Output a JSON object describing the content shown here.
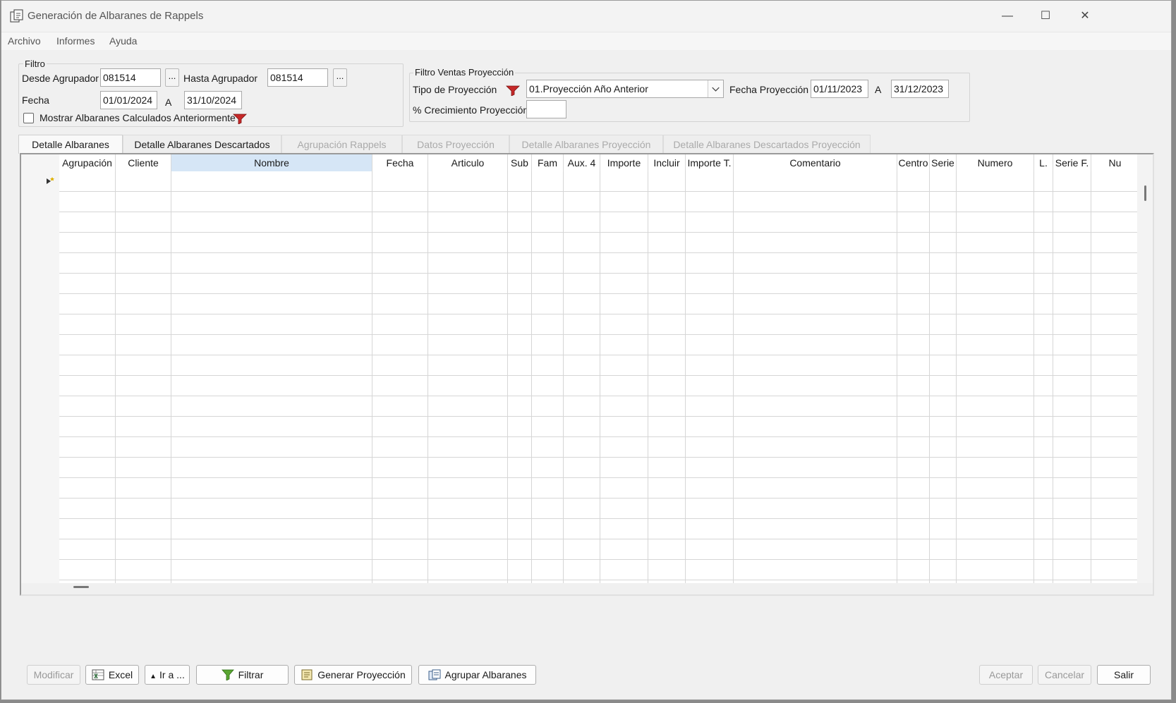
{
  "window": {
    "title": "Generación de Albaranes de Rappels",
    "minimize": "—",
    "maximize": "☐",
    "close": "✕"
  },
  "menu": [
    "Archivo",
    "Informes",
    "Ayuda"
  ],
  "filter": {
    "legend": "Filtro",
    "desde_label": "Desde Agrupador",
    "desde_value": "081514",
    "hasta_label": "Hasta Agrupador",
    "hasta_value": "081514",
    "browse": "...",
    "fecha_label": "Fecha",
    "fecha_from": "01/01/2024",
    "a_label": "A",
    "fecha_to": "31/10/2024",
    "mostrar_label": "Mostrar Albaranes Calculados Anteriormente",
    "mostrar_checked": false
  },
  "projection": {
    "legend": "Filtro Ventas Proyección",
    "tipo_label": "Tipo de Proyección",
    "tipo_value": "01.Proyección Año Anterior",
    "fecha_label": "Fecha Proyección",
    "fecha_from": "01/11/2023",
    "a_label": "A",
    "fecha_to": "31/12/2023",
    "crecimiento_label": "% Crecimiento Proyección",
    "crecimiento_value": ""
  },
  "tabs": [
    {
      "label": "Detalle Albaranes",
      "state": "active"
    },
    {
      "label": "Detalle Albaranes Descartados",
      "state": "enabled"
    },
    {
      "label": "Agrupación Rappels",
      "state": "disabled"
    },
    {
      "label": "Datos Proyección",
      "state": "disabled"
    },
    {
      "label": "Detalle Albaranes Proyección",
      "state": "disabled"
    },
    {
      "label": "Detalle Albaranes Descartados Proyección",
      "state": "disabled"
    }
  ],
  "grid": {
    "columns": [
      "Agrupación",
      "Cliente",
      "Nombre",
      "Fecha",
      "Articulo",
      "Sub",
      "Fam",
      "Aux. 4",
      "Importe",
      "Incluir",
      "Importe T.",
      "Comentario",
      "Centro",
      "Serie",
      "Numero",
      "L.",
      "Serie F.",
      "Nu"
    ],
    "selected_column": "Nombre",
    "rows": []
  },
  "buttons": {
    "modificar": "Modificar",
    "excel": "Excel",
    "ir_a": "Ir a ...",
    "filtrar": "Filtrar",
    "generar": "Generar Proyección",
    "agrupar": "Agrupar Albaranes",
    "aceptar": "Aceptar",
    "cancelar": "Cancelar",
    "salir": "Salir"
  },
  "colors": {
    "selected_header": "#d6e6f6",
    "window_bg": "#f0f0f0",
    "icon_red": "#c62828"
  }
}
